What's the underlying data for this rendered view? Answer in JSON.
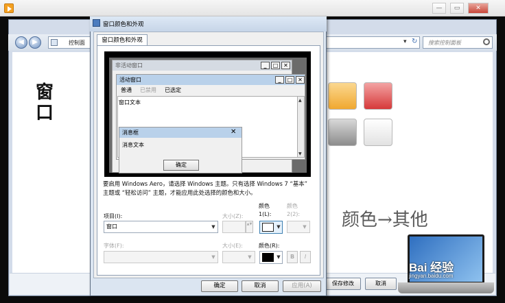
{
  "player": {
    "controls": {
      "minimize": "—",
      "restore": "▭",
      "close": "✕"
    }
  },
  "control_panel": {
    "address": {
      "text": "控制面",
      "dropdown": "▾"
    },
    "search": {
      "placeholder": "搜索控制面板"
    },
    "nav": {
      "back": "◀",
      "forward": "▶",
      "refresh": "↻"
    },
    "theme_colors": [
      "#f5b23a",
      "#d9393a",
      "#9a9a9a",
      "#e9e9e9"
    ],
    "buttons": {
      "save": "保存修改",
      "cancel": "取消"
    }
  },
  "annotations": {
    "window_label": "窗口",
    "color_arrow_other": "颜色→其他"
  },
  "watermark": {
    "brand": "Bai 经验",
    "url": "jingyan.baidu.com"
  },
  "dialog": {
    "title": "窗口颜色和外观",
    "tab": "窗口颜色和外观",
    "caption_buttons": {
      "minimize": "_",
      "maximize": "□",
      "close": "✕"
    },
    "preview": {
      "inactive_title": "非活动窗口",
      "active_title": "活动窗口",
      "menu": [
        "普通",
        "已禁用",
        "已选定"
      ],
      "window_text": "窗口文本",
      "msgbox_title": "消息框",
      "msgbox_text": "消息文本",
      "ok_label": "确定"
    },
    "info": "要启用 Windows Aero，请选择 Windows 主题。只有选择 Windows 7 “基本” 主题或 “轻松访问” 主题，才能应用此处选择的颜色和大小。",
    "form": {
      "item_label": "项目(I):",
      "item_value": "窗口",
      "size_label": "大小(Z):",
      "color1_label_line1": "颜色",
      "color1_label_line2": "1(L):",
      "color2_label_line1": "颜色",
      "color2_label_line2": "2(2):",
      "color1_value": "#ffffff",
      "font_label": "字体(F):",
      "font_size_label": "大小(E):",
      "font_color_label": "颜色(R):",
      "font_color_value": "#000000",
      "bold": "B",
      "italic": "I"
    },
    "buttons": {
      "ok": "确定",
      "cancel": "取消",
      "apply": "应用(A)"
    }
  }
}
